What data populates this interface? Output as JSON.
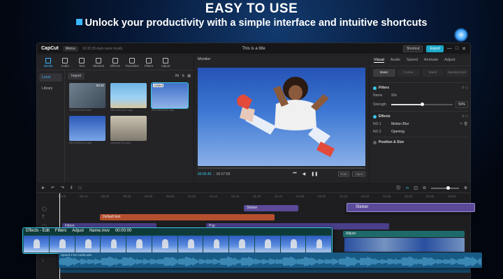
{
  "hero": {
    "title": "EASY TO USE",
    "subtitle": "Unlock your productivity with a simple interface and intuitive shortcuts"
  },
  "titlebar": {
    "app_name": "CapCut",
    "menu_label": "Menu",
    "autosave": "16:30:35 Auto save locally",
    "window_title": "This is a title",
    "shortcut_label": "Shortcut",
    "export_label": "Export",
    "window_controls": [
      "—",
      "□",
      "✕"
    ]
  },
  "media": {
    "tools": [
      {
        "label": "Media",
        "icon": "media-icon"
      },
      {
        "label": "Audio",
        "icon": "audio-icon"
      },
      {
        "label": "Text",
        "icon": "text-icon"
      },
      {
        "label": "Stickers",
        "icon": "sticker-icon"
      },
      {
        "label": "Effects",
        "icon": "effects-icon"
      },
      {
        "label": "Transition",
        "icon": "transition-icon"
      },
      {
        "label": "Filters",
        "icon": "filters-icon"
      },
      {
        "label": "Adjust",
        "icon": "adjust-icon"
      }
    ],
    "side": [
      "Local",
      "Library"
    ],
    "import_label": "Import",
    "filter_label": "All",
    "thumbs": [
      {
        "name": "CR01001024.mov",
        "dur": "00:32",
        "badge": ""
      },
      {
        "name": "RE12302412.mp4",
        "dur": "",
        "badge": ""
      },
      {
        "name": "RE12302412.mp4",
        "dur": "",
        "badge": "Added"
      },
      {
        "name": "RE12302412.mp4",
        "dur": "",
        "badge": ""
      },
      {
        "name": "comerta 01.mp4",
        "dur": "",
        "badge": ""
      }
    ]
  },
  "monitor": {
    "title": "Monitor",
    "time_current": "00:05:45",
    "time_total": "00:07:58",
    "right_buttons": [
      "Ratio",
      "Adjust"
    ]
  },
  "inspector": {
    "tabs": [
      "Visual",
      "Audio",
      "Speed",
      "Animate",
      "Adjust"
    ],
    "subtabs": [
      "Basic",
      "Cutout",
      "Mask",
      "Background"
    ],
    "filters": {
      "title": "Filters",
      "name_label": "Name",
      "name_value": "90s",
      "strength_label": "Strength",
      "strength_value": "50%",
      "strength_level": 0.5
    },
    "effects": {
      "title": "Effects",
      "rows": [
        {
          "label": "NO.1",
          "value": "Motion Blur"
        },
        {
          "label": "NO.2",
          "value": "Opening"
        }
      ]
    },
    "position": {
      "title": "Position & Size"
    }
  },
  "timeline": {
    "ruler": [
      "00:00",
      "00:10",
      "00:20",
      "00:30",
      "00:40",
      "00:50",
      "01:00",
      "01:10",
      "01:20",
      "01:30",
      "01:40",
      "01:50",
      "02:00",
      "02:10",
      "02:20",
      "02:30",
      "02:40",
      "02:50",
      "03:00"
    ],
    "tracks": {
      "sticker1": "Sticker",
      "default_text": "Default text",
      "filters": "Filters",
      "pop": "Pop",
      "adjust2": "Adjust"
    },
    "audio_label": "Speed 2.0x   Audio.wav",
    "zoom_level": 0.6
  },
  "floating": {
    "clip_labels": [
      "Effects - Edit",
      "Filters",
      "Adjust",
      "Name.mov",
      "00:00:00"
    ],
    "sticker_label": "Sticker",
    "audio_label": "Speed 2.0x   Audio.wav"
  },
  "colors": {
    "accent": "#39c8e8",
    "sticker": "#5a4a98",
    "text_track": "#b5502f",
    "filter_track": "#4a3f8a",
    "video_track": "#124a4a",
    "audio_track": "#175a86"
  }
}
